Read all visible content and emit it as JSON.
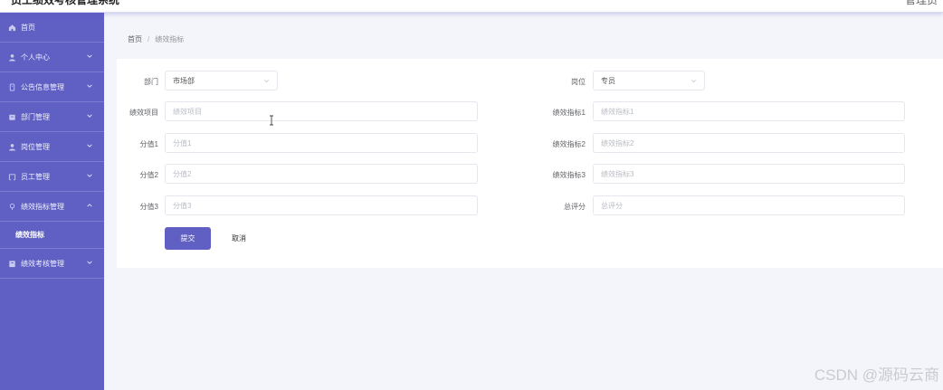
{
  "header": {
    "title": "员工绩效考核管理系统",
    "right": "管理员"
  },
  "sidebar": {
    "items": [
      {
        "label": "首页",
        "icon": "home-icon"
      },
      {
        "label": "个人中心",
        "icon": "user-icon"
      },
      {
        "label": "公告信息管理",
        "icon": "notice-icon"
      },
      {
        "label": "部门管理",
        "icon": "department-icon"
      },
      {
        "label": "岗位管理",
        "icon": "position-icon"
      },
      {
        "label": "员工管理",
        "icon": "staff-icon"
      },
      {
        "label": "绩效指标管理",
        "icon": "indicator-icon"
      },
      {
        "label": "绩效考核管理",
        "icon": "assessment-icon"
      }
    ],
    "submenu": {
      "label": "绩效指标"
    }
  },
  "breadcrumb": {
    "home": "首页",
    "separator": "/",
    "current": "绩效指标"
  },
  "form": {
    "department": {
      "label": "部门",
      "value": "市场部"
    },
    "position": {
      "label": "岗位",
      "value": "专员"
    },
    "project": {
      "label": "绩效项目",
      "placeholder": "绩效项目"
    },
    "indicator1": {
      "label": "绩效指标1",
      "placeholder": "绩效指标1"
    },
    "score1": {
      "label": "分值1",
      "placeholder": "分值1"
    },
    "indicator2": {
      "label": "绩效指标2",
      "placeholder": "绩效指标2"
    },
    "score2": {
      "label": "分值2",
      "placeholder": "分值2"
    },
    "indicator3": {
      "label": "绩效指标3",
      "placeholder": "绩效指标3"
    },
    "score3": {
      "label": "分值3",
      "placeholder": "分值3"
    },
    "total": {
      "label": "总评分",
      "placeholder": "总评分"
    },
    "submit_label": "提交",
    "cancel_label": "取消"
  },
  "watermark": "CSDN @源码云商",
  "colors": {
    "sidebar": "#5f5fc4",
    "primary": "#5f5fc4",
    "background": "#f4f5fa"
  }
}
